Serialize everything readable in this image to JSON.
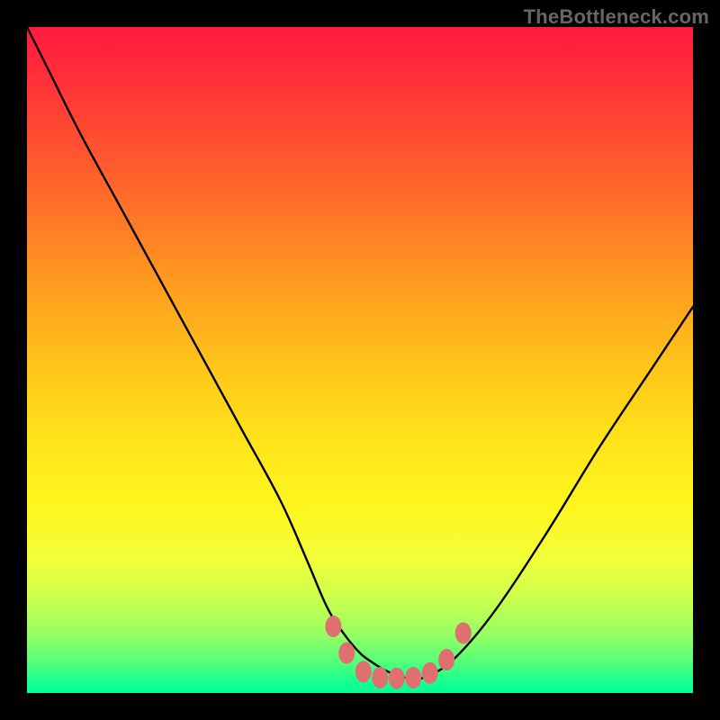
{
  "attribution": "TheBottleneck.com",
  "colors": {
    "frame": "#000000",
    "gradient_top": "#ff1a40",
    "gradient_mid": "#ffe31a",
    "gradient_bottom": "#00ff99",
    "curve": "#000000",
    "marker": "#e07070"
  },
  "chart_data": {
    "type": "line",
    "title": "",
    "xlabel": "",
    "ylabel": "",
    "xlim": [
      0,
      100
    ],
    "ylim": [
      0,
      100
    ],
    "grid": false,
    "legend": false,
    "series": [
      {
        "name": "curve",
        "x": [
          0,
          3,
          8,
          14,
          20,
          26,
          32,
          38,
          42,
          45,
          47.5,
          50,
          52,
          54,
          56,
          58,
          60,
          64,
          70,
          78,
          86,
          94,
          100
        ],
        "y": [
          100,
          94,
          84,
          73,
          62,
          51,
          40,
          29,
          20,
          13,
          9,
          6,
          4.5,
          3.3,
          2.5,
          2.2,
          2.5,
          5,
          12,
          24,
          37,
          49,
          58
        ]
      }
    ],
    "markers": [
      {
        "x": 46,
        "y": 10
      },
      {
        "x": 48,
        "y": 6
      },
      {
        "x": 50.5,
        "y": 3.2
      },
      {
        "x": 53,
        "y": 2.3
      },
      {
        "x": 55.5,
        "y": 2.2
      },
      {
        "x": 58,
        "y": 2.3
      },
      {
        "x": 60.5,
        "y": 3
      },
      {
        "x": 63,
        "y": 5
      },
      {
        "x": 65.5,
        "y": 9
      }
    ]
  }
}
